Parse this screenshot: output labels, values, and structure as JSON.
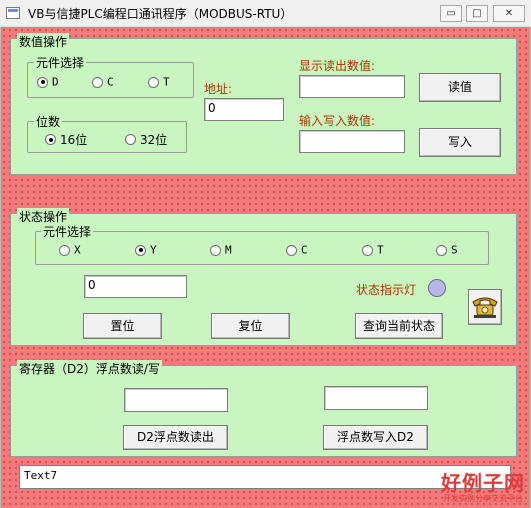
{
  "window": {
    "title": "VB与信捷PLC编程口通讯程序（MODBUS-RTU）",
    "min_glyph": "▭",
    "max_glyph": "□",
    "close_glyph": "✕"
  },
  "data_frame": {
    "title": "数值操作",
    "element_group": {
      "title": "元件选择",
      "options": [
        {
          "label": "D",
          "checked": true
        },
        {
          "label": "C",
          "checked": false
        },
        {
          "label": "T",
          "checked": false
        }
      ]
    },
    "bits_group": {
      "title": "位数",
      "options": [
        {
          "label": "16位",
          "checked": true
        },
        {
          "label": "32位",
          "checked": false
        }
      ]
    },
    "address_label": "地址:",
    "address_value": "0",
    "read_label": "显示读出数值:",
    "read_value": "",
    "read_button": "读值",
    "write_label": "输入写入数值:",
    "write_value": "",
    "write_button": "写入"
  },
  "status_frame": {
    "title": "状态操作",
    "element_group": {
      "title": "元件选择",
      "options": [
        {
          "label": "X",
          "checked": false
        },
        {
          "label": "Y",
          "checked": true
        },
        {
          "label": "M",
          "checked": false
        },
        {
          "label": "C",
          "checked": false
        },
        {
          "label": "T",
          "checked": false
        },
        {
          "label": "S",
          "checked": false
        }
      ]
    },
    "address_value": "0",
    "indicator_label": "状态指示灯",
    "indicator_color": "#b9b6e8",
    "set_button": "置位",
    "reset_button": "复位",
    "query_button": "查询当前状态",
    "phone_icon": "telephone-icon"
  },
  "register_frame": {
    "title": "寄存器（D2）浮点数读/写",
    "read_value": "",
    "write_value": "",
    "read_button": "D2浮点数读出",
    "write_button": "浮点数写入D2"
  },
  "status_text": "Text7",
  "watermark": {
    "line1": "好例子网",
    "line2": "开发实例分享交流平台"
  }
}
